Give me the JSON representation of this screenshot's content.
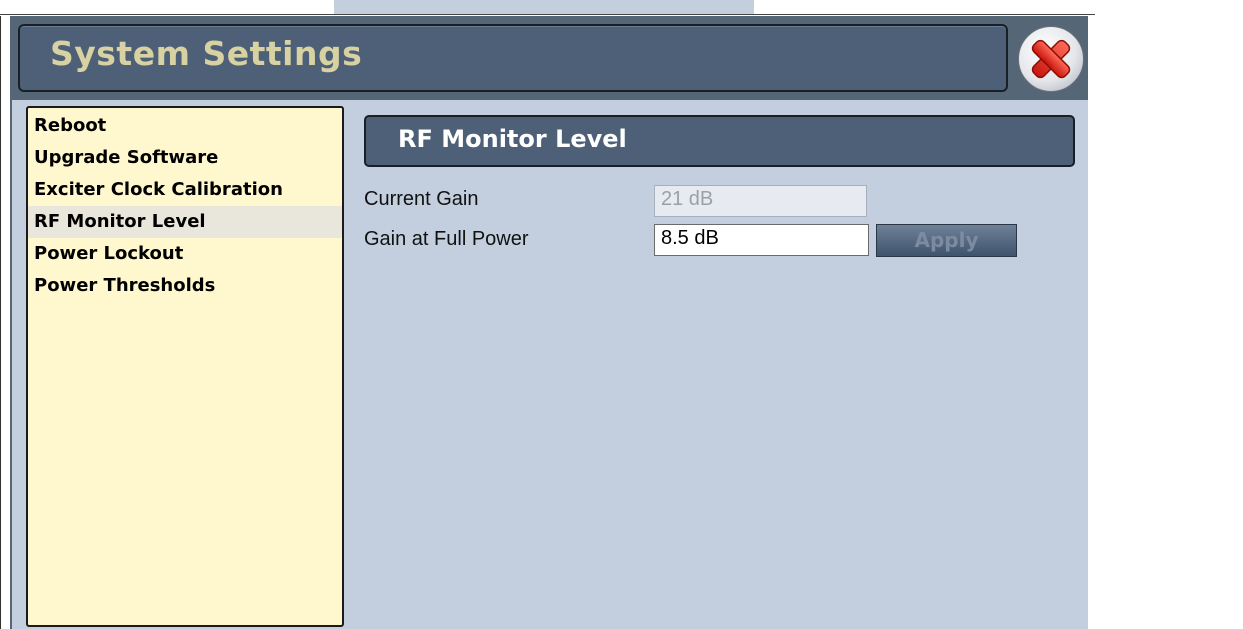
{
  "window": {
    "title": "System Settings"
  },
  "menu": {
    "items": [
      {
        "label": "Reboot"
      },
      {
        "label": "Upgrade Software"
      },
      {
        "label": "Exciter Clock Calibration"
      },
      {
        "label": "RF Monitor Level",
        "selected": true
      },
      {
        "label": "Power Lockout"
      },
      {
        "label": "Power Thresholds"
      }
    ]
  },
  "panel": {
    "title": "RF Monitor Level",
    "current_gain": {
      "label": "Current Gain",
      "value": "21 dB"
    },
    "gain_full_power": {
      "label": "Gain at Full Power",
      "value": "8.5 dB"
    },
    "apply_label": "Apply"
  },
  "colors": {
    "title_text": "#d8d1a2",
    "menu_background": "#fff8cf",
    "panel_background": "#c3cfdf",
    "header_background": "#4e6078"
  },
  "icons": {
    "close": "close-x-icon"
  }
}
